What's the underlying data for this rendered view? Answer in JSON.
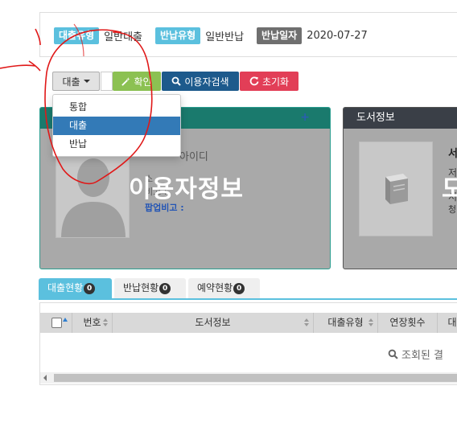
{
  "info": {
    "loan_type_label": "대출유형",
    "loan_type_value": "일반대출",
    "return_type_label": "반납유형",
    "return_type_value": "일반반납",
    "return_date_label": "반납일자",
    "return_date_value": "2020-07-27"
  },
  "toolbar": {
    "mode_selected": "대출",
    "confirm_label": "확인",
    "user_search_label": "이용자검색",
    "reset_label": "초기화"
  },
  "mode_menu": {
    "options": [
      "통합",
      "대출",
      "반납"
    ],
    "selected": "대출"
  },
  "user_panel": {
    "plus": "+",
    "id_label": "아이디",
    "line1": "소",
    "line2": "비고 :",
    "popup_memo_label": "팝업비고 :",
    "overlay_title": "이용자정보"
  },
  "book_panel": {
    "title": "도서정보",
    "overlay_title": "도",
    "c1": "서",
    "c2": "저",
    "c3": "서",
    "c4": "청"
  },
  "tabs": [
    {
      "label": "대출현황",
      "count": "0"
    },
    {
      "label": "반납현황",
      "count": "0"
    },
    {
      "label": "예약현황",
      "count": "0"
    }
  ],
  "grid": {
    "columns": [
      "번호",
      "도서정보",
      "대출유형",
      "연장횟수",
      "대"
    ],
    "empty_message": "조회된 결"
  },
  "colors": {
    "label_blue": "#5bc0de",
    "label_gray": "#6f6f6f",
    "confirm_green": "#8cc152",
    "search_navy": "#1d5a8c",
    "reset_red": "#e23e57",
    "menu_active": "#337ab7",
    "annotation_red": "#e01818"
  }
}
